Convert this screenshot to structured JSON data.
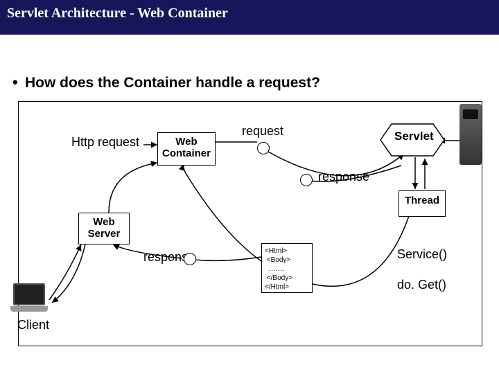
{
  "title": "Servlet Architecture - Web Container",
  "bullet": "How does the Container handle a request?",
  "labels": {
    "http_request": "Http request",
    "web_container": "Web\nContainer",
    "request": "request",
    "response_top": "response",
    "web_server": "Web\nServer",
    "response_bottom": "response",
    "client": "Client",
    "servlet": "Servlet",
    "thread": "Thread",
    "service": "Service()",
    "doget": "do. Get()",
    "html_snippet": "<Html>\n <Body>\n  …….\n </Body>\n</Html>"
  }
}
